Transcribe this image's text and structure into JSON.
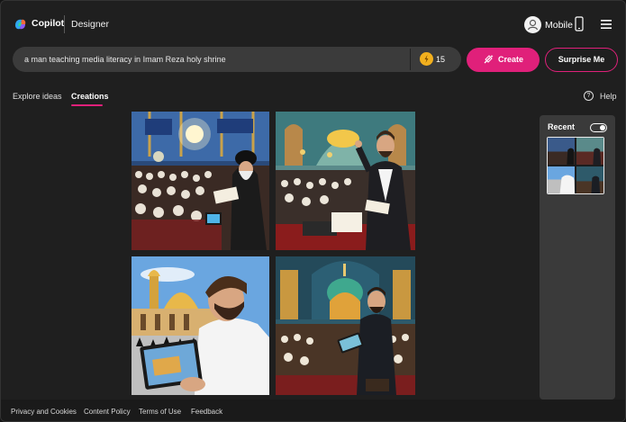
{
  "header": {
    "brand": "Copilot",
    "product": "Designer",
    "mobile_label": "Mobile",
    "icons": [
      "copilot-logo",
      "avatar-icon",
      "phone-icon",
      "hamburger-menu-icon"
    ]
  },
  "prompt": {
    "value": "a man teaching media literacy in Imam Reza holy shrine",
    "boosts": "15"
  },
  "actions": {
    "create": "Create",
    "surprise": "Surprise Me"
  },
  "tabs": [
    {
      "label": "Explore ideas",
      "active": false
    },
    {
      "label": "Creations",
      "active": true
    }
  ],
  "help": {
    "label": "Help",
    "glyph": "?"
  },
  "images": [
    {
      "subject": "cleric-reading-to-crowd"
    },
    {
      "subject": "speaker-raising-hand-in-shrine"
    },
    {
      "subject": "man-with-tablet-at-golden-dome"
    },
    {
      "subject": "man-with-tablet-on-stage"
    }
  ],
  "recent": {
    "label": "Recent",
    "toggle_on": true
  },
  "footer": {
    "links": [
      "Privacy and Cookies",
      "Content Policy",
      "Terms of Use",
      "Feedback"
    ]
  },
  "colors": {
    "accent": "#e0207a",
    "background": "#1f1f1f",
    "panel": "#3a3a3a",
    "boost_coin": "#f2b01e"
  }
}
